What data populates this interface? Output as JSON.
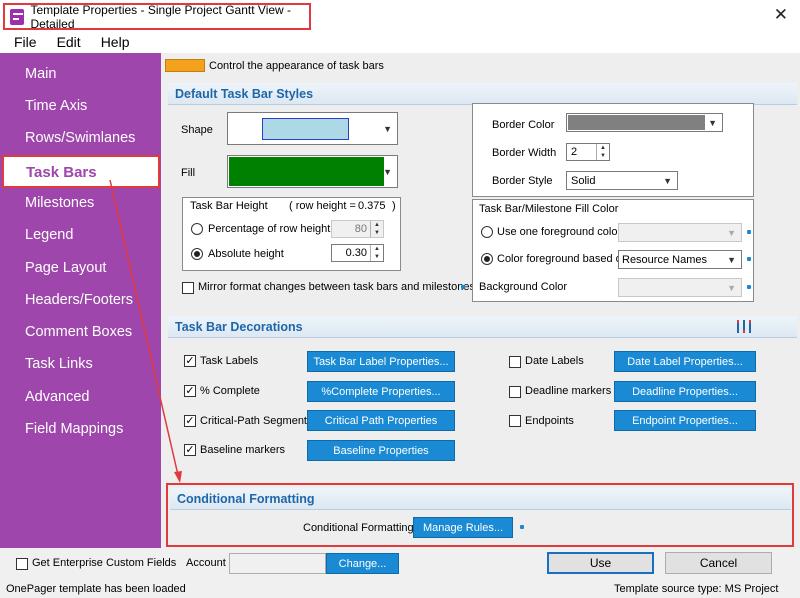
{
  "window": {
    "title": "Template Properties - Single Project Gantt View - Detailed"
  },
  "menu": [
    "File",
    "Edit",
    "Help"
  ],
  "sidebar": {
    "items": [
      "Main",
      "Time Axis",
      "Rows/Swimlanes",
      "Task Bars",
      "Milestones",
      "Legend",
      "Page Layout",
      "Headers/Footers",
      "Comment Boxes",
      "Task Links",
      "Advanced",
      "Field Mappings"
    ],
    "active": "Task Bars"
  },
  "header": {
    "description": "Control the appearance of task bars"
  },
  "default_styles": {
    "title": "Default Task Bar Styles",
    "shape_label": "Shape",
    "fill_label": "Fill",
    "colors": {
      "shape_swatch": "#add8e6",
      "fill_swatch": "#008000",
      "border_swatch": "#808080"
    },
    "height_group_title": "Task Bar Height",
    "row_height_label": "( row height =",
    "row_height_value": "0.375",
    "row_height_close": ")",
    "pct_label": "Percentage of row height",
    "pct_value": "80",
    "abs_label": "Absolute height",
    "abs_value": "0.30",
    "border_color_label": "Border Color",
    "border_width_label": "Border Width",
    "border_width_value": "2",
    "border_style_label": "Border Style",
    "border_style_value": "Solid",
    "fill_group_title": "Task Bar/Milestone Fill Color",
    "use_one_label": "Use one foreground color:",
    "color_based_label": "Color foreground based on",
    "color_based_value": "Resource Names",
    "background_label": "Background Color",
    "mirror_label": "Mirror format changes between task bars and milestones"
  },
  "decorations": {
    "title": "Task Bar Decorations",
    "left": [
      {
        "label": "Task Labels",
        "checked": true,
        "button": "Task Bar Label Properties..."
      },
      {
        "label": "% Complete",
        "checked": true,
        "button": "%Complete Properties..."
      },
      {
        "label": "Critical-Path Segments",
        "checked": true,
        "button": "Critical Path Properties"
      },
      {
        "label": "Baseline markers",
        "checked": true,
        "button": "Baseline Properties"
      }
    ],
    "right": [
      {
        "label": "Date Labels",
        "checked": false,
        "button": "Date Label Properties..."
      },
      {
        "label": "Deadline markers",
        "checked": false,
        "button": "Deadline Properties..."
      },
      {
        "label": "Endpoints",
        "checked": false,
        "button": "Endpoint Properties..."
      }
    ]
  },
  "conditional": {
    "title": "Conditional Formatting",
    "label": "Conditional Formatting",
    "button": "Manage Rules..."
  },
  "bottom": {
    "enterprise_label": "Get Enterprise Custom Fields",
    "account_label": "Account",
    "change_button": "Change...",
    "use_button": "Use",
    "cancel_button": "Cancel"
  },
  "status": {
    "left": "OnePager template has been loaded",
    "right": "Template source type: MS Project"
  },
  "accent_colors": {
    "sidebar": "#9e46ab",
    "highlight": "#e0393e",
    "button": "#1a8ad4"
  }
}
